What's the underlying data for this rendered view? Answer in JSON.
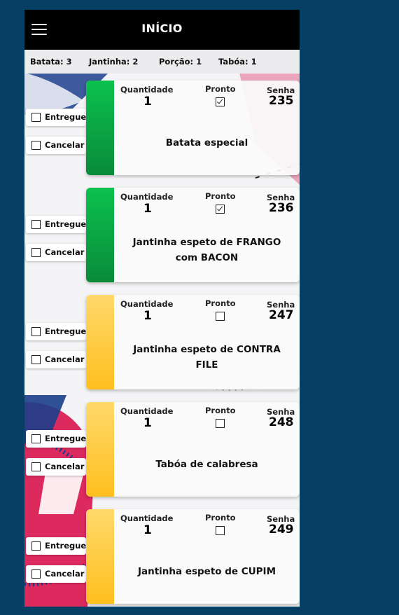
{
  "header": {
    "title": "INÍCIO",
    "menu_icon": "hamburger-icon"
  },
  "summary": [
    {
      "label": "Batata: 3"
    },
    {
      "label": "Jantinha: 2"
    },
    {
      "label": "Porção: 1"
    },
    {
      "label": "Tabóa: 1"
    }
  ],
  "labels": {
    "quantity": "Quantidade",
    "ready": "Pronto",
    "ticket": "Senha",
    "delivered": "Entregue",
    "cancel": "Cancelar"
  },
  "orders": [
    {
      "quantity": "1",
      "ready": true,
      "ticket": "235",
      "item": "Batata especial",
      "status_color": "#0bc24e"
    },
    {
      "quantity": "1",
      "ready": true,
      "ticket": "236",
      "item": "Jantinha espeto de FRANGO com BACON",
      "status_color": "#0bc24e"
    },
    {
      "quantity": "1",
      "ready": false,
      "ticket": "247",
      "item": "Jantinha espeto de CONTRA FILE",
      "status_color": "#ffc933"
    },
    {
      "quantity": "1",
      "ready": false,
      "ticket": "248",
      "item": "Tabóa de calabresa",
      "status_color": "#ffc933"
    },
    {
      "quantity": "1",
      "ready": false,
      "ticket": "249",
      "item": "Jantinha espeto de CUPIM",
      "status_color": "#ffc933"
    }
  ]
}
